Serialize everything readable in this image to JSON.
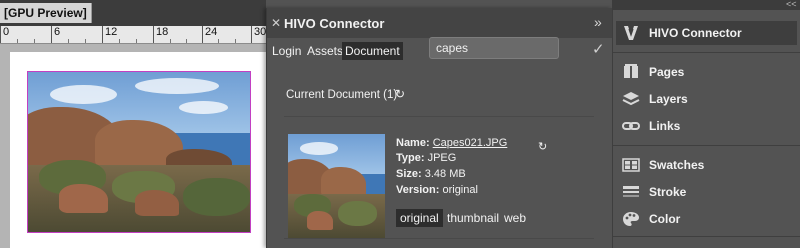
{
  "document_window": {
    "tab_label": "[GPU Preview]",
    "ruler_ticks": [
      "0",
      "6",
      "12",
      "18",
      "24",
      "30"
    ]
  },
  "hivo_panel": {
    "close_icon": "✕",
    "title": "HIVO Connector",
    "collapse_icon": "»",
    "nav": {
      "login": "Login",
      "assets": "Assets",
      "document": "Document"
    },
    "search": {
      "value": "capes",
      "placeholder": ""
    },
    "confirm_icon": "✓",
    "current_document_label": "Current Document (1)",
    "refresh_icon": "↻",
    "asset": {
      "name_label": "Name:",
      "name_value": "Capes021.JPG",
      "type_label": "Type:",
      "type_value": "JPEG",
      "size_label": "Size:",
      "size_value": "3.48 MB",
      "version_label": "Version:",
      "version_value": "original",
      "renditions": [
        "original",
        "thumbnail",
        "web"
      ],
      "selected_rendition": "original"
    }
  },
  "dock": {
    "collapse_icon": "<<",
    "items": [
      {
        "label": "HIVO Connector",
        "icon": "hivo-logo-icon"
      },
      {
        "label": "Pages",
        "icon": "pages-icon"
      },
      {
        "label": "Layers",
        "icon": "layers-icon"
      },
      {
        "label": "Links",
        "icon": "links-icon"
      },
      {
        "label": "Swatches",
        "icon": "swatches-icon"
      },
      {
        "label": "Stroke",
        "icon": "stroke-icon"
      },
      {
        "label": "Color",
        "icon": "color-icon"
      }
    ],
    "active_item": "HIVO Connector"
  },
  "colors": {
    "panel_bg": "#535353",
    "frame_border": "#c23fc2",
    "active_tab_bg": "#2d2d2d"
  }
}
